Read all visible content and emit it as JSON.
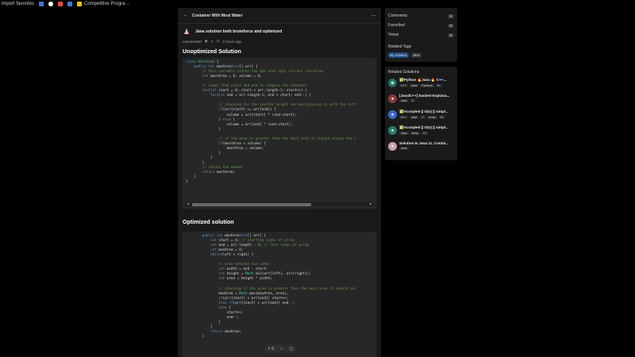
{
  "bookmarks": {
    "items": [
      {
        "label": "import favorites",
        "color": "#000000"
      },
      {
        "label": "",
        "color": "#3a7bd5"
      },
      {
        "label": "",
        "color": "#ffffff"
      },
      {
        "label": "",
        "color": "#e74c3c"
      },
      {
        "label": "",
        "color": "#3a7bd5"
      },
      {
        "label": "Competitive Progra...",
        "color": "#f1c40f"
      }
    ]
  },
  "topbar": {
    "title": "Container With Most Water"
  },
  "post": {
    "title": "Java solution both bruteforce and optimized",
    "author": "maniesta00",
    "views": "0",
    "time": "2 hours ago"
  },
  "section1": {
    "heading": "Unoptimized Solution"
  },
  "section2": {
    "heading": "Optimized solution"
  },
  "floatbar": {
    "votes": "0"
  },
  "stats": {
    "comments_label": "Comments",
    "comments": "0",
    "favorited_label": "Favorited",
    "favorited": "0",
    "views_label": "Views",
    "views": "3",
    "tags_title": "Related Tags",
    "tags": [
      "My Solution",
      "Java"
    ]
  },
  "related": {
    "title": "Related Solutions",
    "items": [
      {
        "name": "✅Python 🔥Java 🔥 C++...",
        "tags": [
          "C++",
          "Java",
          "Python3",
          "2+"
        ],
        "avatar_color": "#2a6a5a",
        "avatar_text": "◉"
      },
      {
        "name": "[Java/C++] Easiest Explana...",
        "tags": [
          "Java",
          "C"
        ],
        "avatar_color": "#8b3a3a",
        "avatar_text": "●"
      },
      {
        "name": "✅Accepted || O(n) || simpl...",
        "tags": [
          "C++",
          "Java",
          "C",
          "Array",
          "5+"
        ],
        "avatar_color": "#3a6ac9",
        "avatar_text": "●"
      },
      {
        "name": "✅Accepted || O(n) || simpl...",
        "tags": [
          "Java",
          "Array",
          "2+"
        ],
        "avatar_color": "#2a7a6a",
        "avatar_text": "●"
      },
      {
        "name": "Solution In Java 11. Contai...",
        "tags": [
          "Java"
        ],
        "avatar_color": "#c9a0b0",
        "avatar_text": "●"
      }
    ]
  }
}
